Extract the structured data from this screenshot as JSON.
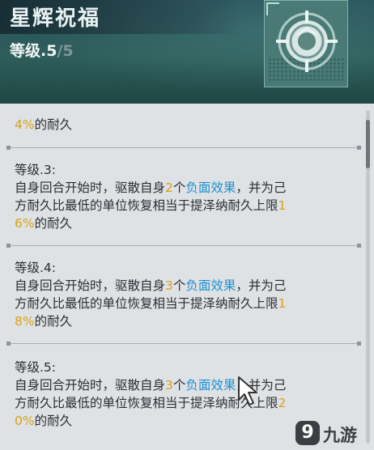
{
  "header": {
    "title": "星辉祝福",
    "level_label": "等级.5",
    "level_sep": "/",
    "level_max": "5",
    "icon": "crosshair-emblem-icon"
  },
  "entries": [
    {
      "id": "partial",
      "lines": [
        [
          {
            "t": "4%",
            "c": "y"
          },
          {
            "t": "的耐久"
          }
        ]
      ]
    },
    {
      "id": "lv3",
      "heading": "等级.3:",
      "lines": [
        [
          {
            "t": "自身回合开始时，驱散自身"
          },
          {
            "t": "2",
            "c": "y"
          },
          {
            "t": "个"
          },
          {
            "t": "负面效果",
            "c": "b"
          },
          {
            "t": "，并为己"
          }
        ],
        [
          {
            "t": "方耐久比最低的单位恢复相当于提泽纳耐久上限"
          },
          {
            "t": "1",
            "c": "y"
          }
        ],
        [
          {
            "t": "6%",
            "c": "y"
          },
          {
            "t": "的耐久"
          }
        ]
      ]
    },
    {
      "id": "lv4",
      "heading": "等级.4:",
      "lines": [
        [
          {
            "t": "自身回合开始时，驱散自身"
          },
          {
            "t": "3",
            "c": "y"
          },
          {
            "t": "个"
          },
          {
            "t": "负面效果",
            "c": "b"
          },
          {
            "t": "，并为己"
          }
        ],
        [
          {
            "t": "方耐久比最低的单位恢复相当于提泽纳耐久上限"
          },
          {
            "t": "1",
            "c": "y"
          }
        ],
        [
          {
            "t": "8%",
            "c": "y"
          },
          {
            "t": "的耐久"
          }
        ]
      ]
    },
    {
      "id": "lv5",
      "heading": "等级.5:",
      "lines": [
        [
          {
            "t": "自身回合开始时，驱散自身"
          },
          {
            "t": "3",
            "c": "y"
          },
          {
            "t": "个"
          },
          {
            "t": "负面效果",
            "c": "b"
          },
          {
            "t": "，并为己"
          }
        ],
        [
          {
            "t": "方耐久比最低的单位恢复相当于提泽纳耐久上限"
          },
          {
            "t": "2",
            "c": "y"
          }
        ],
        [
          {
            "t": "0%",
            "c": "y"
          },
          {
            "t": "的耐久"
          }
        ]
      ]
    }
  ],
  "watermark": {
    "logo": "9",
    "name": "九游"
  },
  "colors": {
    "highlight_yellow": "#d6a21a",
    "highlight_blue": "#1c8fd0",
    "body_text": "#2a2e33"
  }
}
